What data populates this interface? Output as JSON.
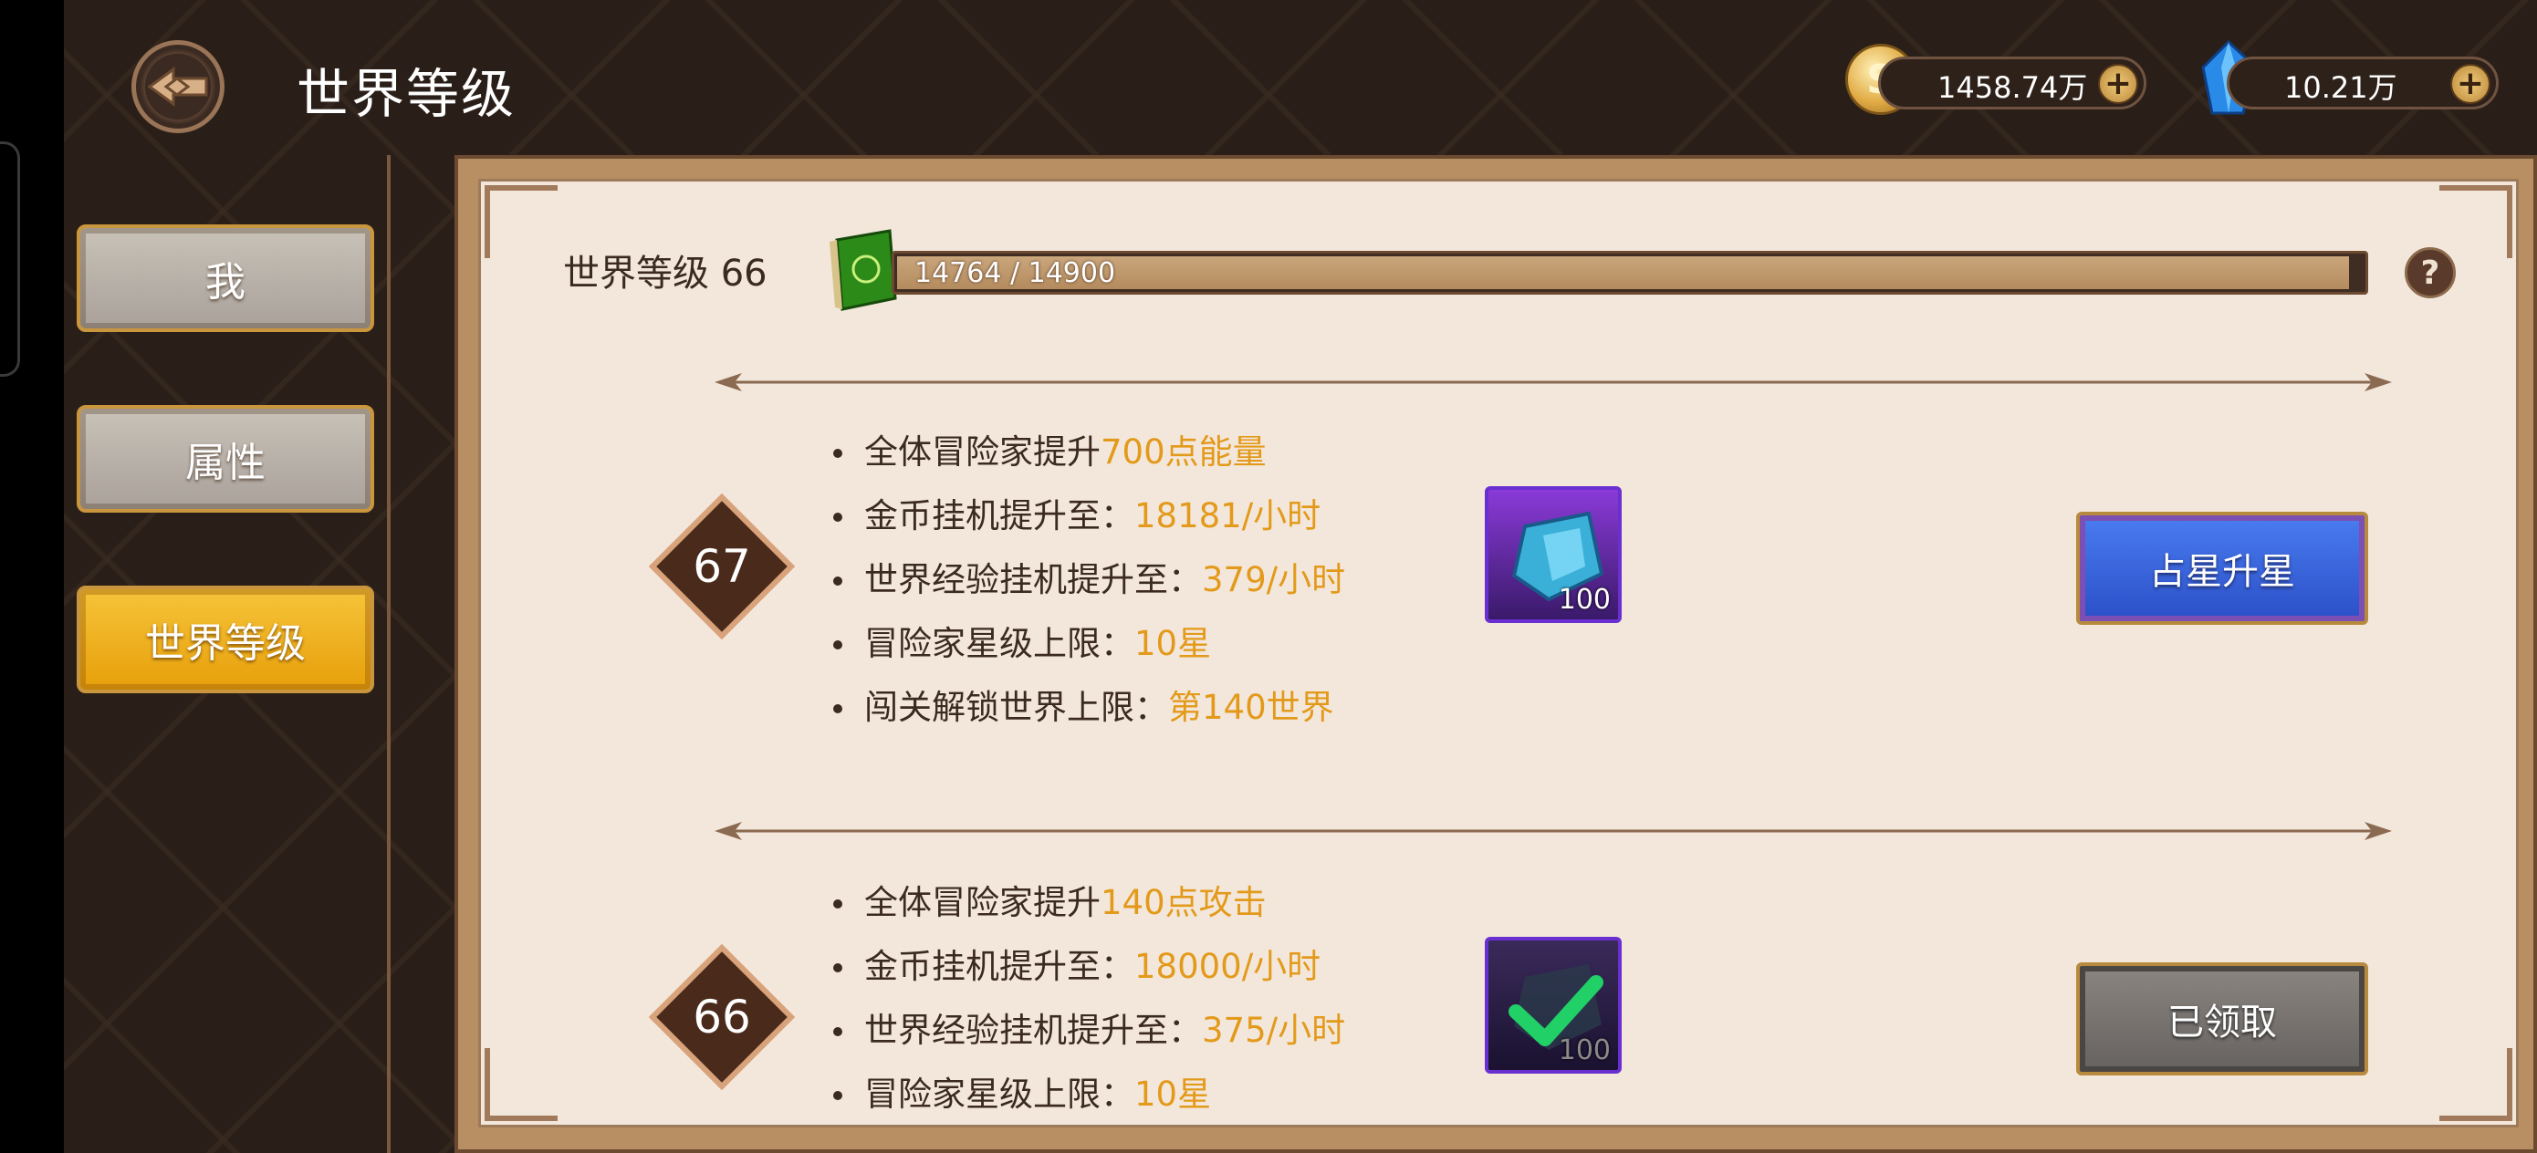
{
  "header": {
    "title": "世界等级",
    "gold_amount": "1458.74万",
    "gem_amount": "10.21万",
    "plus": "+"
  },
  "sidebar": {
    "items": [
      {
        "label": "我",
        "selected": false
      },
      {
        "label": "属性",
        "selected": false
      },
      {
        "label": "世界等级",
        "selected": true
      }
    ]
  },
  "world_level": {
    "label": "世界等级 66",
    "xp_text": "14764 / 14900",
    "xp_progress": 0.991,
    "help": "?"
  },
  "levels": [
    {
      "level": "67",
      "rewards": [
        {
          "prefix": "全体冒险家提升",
          "value": "700点能量"
        },
        {
          "prefix": "金币挂机提升至：",
          "value": "18181/小时"
        },
        {
          "prefix": "世界经验挂机提升至：",
          "value": "379/小时"
        },
        {
          "prefix": "冒险家星级上限：",
          "value": "10星"
        },
        {
          "prefix": "闯关解锁世界上限：",
          "value": "第140世界"
        }
      ],
      "item_qty": "100",
      "button_label": "占星升星"
    },
    {
      "level": "66",
      "rewards": [
        {
          "prefix": "全体冒险家提升",
          "value": "140点攻击"
        },
        {
          "prefix": "金币挂机提升至：",
          "value": "18000/小时"
        },
        {
          "prefix": "世界经验挂机提升至：",
          "value": "375/小时"
        },
        {
          "prefix": "冒险家星级上限：",
          "value": "10星"
        }
      ],
      "item_qty": "100",
      "button_label": "已领取"
    }
  ],
  "colors": {
    "highlight": "#e39a1a",
    "text": "#3b2a20",
    "selected_tab": "#f0b020"
  },
  "icons": [
    "back-icon",
    "coin-icon",
    "crystal-icon",
    "book-icon",
    "help-icon",
    "crystal-item-icon",
    "check-icon"
  ]
}
